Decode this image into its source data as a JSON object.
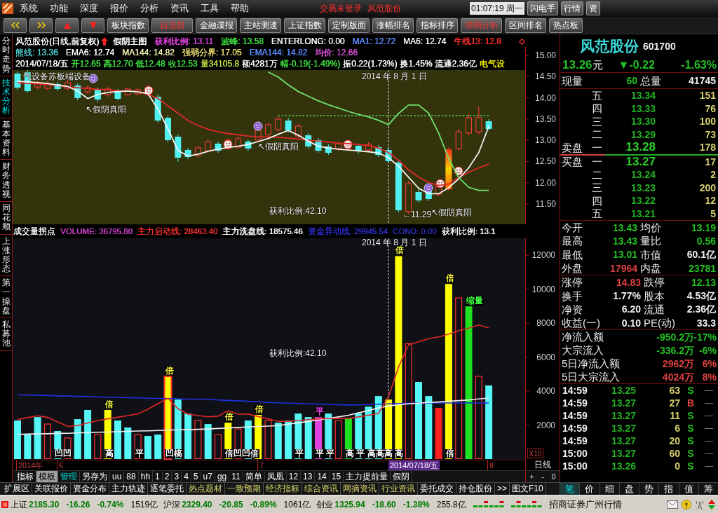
{
  "menu_bar": {
    "items": [
      "系统",
      "功能",
      "深度",
      "报价",
      "分析",
      "资讯",
      "工具",
      "帮助"
    ],
    "notices": [
      "交易未登录",
      "风范股份"
    ],
    "clock": "01:07:19 周一",
    "buttons": [
      "闪电手",
      "行情",
      "资"
    ]
  },
  "toolbar": {
    "buttons": [
      {
        "label": "板块指数",
        "highlighted": false
      },
      {
        "label": "自选股",
        "highlighted": true
      },
      {
        "label": "金融谍报",
        "highlighted": false
      },
      {
        "label": "主站测速",
        "highlighted": false
      },
      {
        "label": "上证指数",
        "highlighted": false
      },
      {
        "label": "定制版面",
        "highlighted": false
      },
      {
        "label": "涨幅排名",
        "highlighted": false
      },
      {
        "label": "指标排序",
        "highlighted": false
      },
      {
        "label": "强弱分析",
        "highlighted": true
      },
      {
        "label": "区间排名",
        "highlighted": false
      },
      {
        "label": "热点板",
        "highlighted": false
      }
    ]
  },
  "side_tabs": [
    {
      "label": "分时走势",
      "selected": false
    },
    {
      "label": "技术分析",
      "selected": true
    },
    {
      "label": "基本资料",
      "selected": false
    },
    {
      "label": "财务透视",
      "selected": false
    },
    {
      "label": "同花顺",
      "selected": false
    },
    {
      "label": "上涨形态",
      "selected": false
    },
    {
      "label": "第一操盘",
      "selected": false
    },
    {
      "label": "私募池",
      "selected": false
    }
  ],
  "chart_header": {
    "lines": [
      [
        {
          "text": "风范股份(日线,前复权)",
          "color": "#ffffff"
        },
        {
          "text": "假阴主图",
          "color": "#ffffff"
        },
        {
          "text": "获利比例: 13.11",
          "color": "#e040e0"
        },
        {
          "text": "波峰: 13.58",
          "color": "#40e040"
        },
        {
          "text": "ENTERLONG: 0.00",
          "color": "#ffffff"
        },
        {
          "text": "MA1: 12.72",
          "color": "#5a8cff"
        },
        {
          "text": "MA6: 12.74",
          "color": "#ffffff"
        },
        {
          "text": "牛线13: 12.8",
          "color": "#ff3030"
        }
      ],
      [
        {
          "text": "熊线: 13.36",
          "color": "#50d0d0"
        },
        {
          "text": "EMA6: 12.74",
          "color": "#ffffff"
        },
        {
          "text": "MA144: 14.82",
          "color": "#f0f0b0"
        },
        {
          "text": "强弱分界: 17.05",
          "color": "#f0e070"
        },
        {
          "text": "EMA144: 14.82",
          "color": "#5a8cff"
        },
        {
          "text": "均价: 12.66",
          "color": "#d050d0"
        }
      ],
      [
        {
          "text": "2014/07/18/五",
          "color": "#ffffff"
        },
        {
          "text": "开12.65",
          "color": "#40e040"
        },
        {
          "text": "高12.70",
          "color": "#40e040"
        },
        {
          "text": "低12.48",
          "color": "#40e040"
        },
        {
          "text": "收12.53",
          "color": "#40e040"
        },
        {
          "text": "量34105.8",
          "color": "#c0e040"
        },
        {
          "text": "额4281万",
          "color": "#ffffff"
        },
        {
          "text": "幅-0.19(-1.49%)",
          "color": "#40e040"
        },
        {
          "text": "振0.22(1.73%)",
          "color": "#ffffff"
        },
        {
          "text": "换1.45%",
          "color": "#ffffff"
        },
        {
          "text": "流通2.36亿",
          "color": "#ffffff"
        },
        {
          "text": "电气设",
          "color": "#f0f000"
        }
      ]
    ]
  },
  "price_chart": {
    "labels": [
      "气设备苏板端设备",
      "2014 年 8 月 1 日",
      "↖假阴真阳",
      "↖假阴真阳",
      "获利比例:42.10",
      "←11.29",
      "↖假阴真阳"
    ],
    "chart_data": {
      "type": "line",
      "categories": [
        null,
        null,
        null,
        null,
        null,
        null,
        null,
        null,
        null,
        null,
        null,
        null,
        null,
        null,
        null,
        null,
        null,
        null,
        null,
        null,
        null,
        null,
        null,
        null,
        null,
        null,
        null,
        null,
        null,
        null,
        null,
        null,
        null,
        null,
        null,
        null,
        null,
        null,
        null,
        null,
        null,
        null,
        null,
        null,
        null,
        null,
        null,
        null
      ],
      "ylim": [
        11.02,
        15.2
      ],
      "yticks": [
        {
          "value": 15,
          "label": "15.00"
        },
        {
          "value": 14.5,
          "label": "14.50"
        },
        {
          "value": 14,
          "label": "14.00"
        },
        {
          "value": 13.5,
          "label": "13.50"
        },
        {
          "value": 13,
          "label": "13.00"
        },
        {
          "value": 12.5,
          "label": "12.50"
        },
        {
          "value": 12,
          "label": "12.00"
        },
        {
          "value": 11.5,
          "label": "11.50"
        }
      ],
      "series": [
        {
          "color": "#e02828",
          "values": [
            14.36,
            14.34,
            14.33,
            14.31,
            14.29,
            14.26,
            14.24,
            14.22,
            14.2,
            14.19,
            14.17,
            14.16,
            14.15,
            14.08,
            13.99,
            13.81,
            13.64,
            13.47,
            13.35,
            13.26,
            13.2,
            13.16,
            13.13,
            13.1,
            13.08,
            13.08,
            13.07,
            13.05,
            13.03,
            13.0,
            12.98,
            12.96,
            12.93,
            12.92,
            12.9,
            12.87,
            12.82,
            12.71,
            12.53,
            12.3,
            12.13,
            12.01,
            11.93,
            11.97,
            12.12,
            12.25,
            12.35,
            12.44
          ]
        },
        {
          "color": "#f4f4f4",
          "values": [
            14.39,
            14.38,
            14.36,
            14.34,
            14.3,
            14.27,
            14.16,
            13.98,
            14.08,
            14.13,
            14.15,
            14.16,
            14.14,
            14.1,
            13.74,
            13.27,
            12.76,
            12.63,
            12.67,
            12.74,
            12.79,
            12.83,
            12.86,
            12.9,
            12.97,
            13.04,
            13.14,
            13.23,
            13.12,
            12.98,
            12.86,
            12.82,
            12.79,
            12.77,
            12.75,
            12.73,
            12.7,
            12.59,
            12.39,
            12.13,
            11.87,
            11.74,
            11.74,
            11.88,
            12.09,
            12.35,
            12.71,
            13.33
          ]
        },
        {
          "color": "#70e070",
          "values": [
            null,
            null,
            null,
            null,
            null,
            null,
            null,
            null,
            null,
            null,
            null,
            null,
            null,
            null,
            null,
            null,
            null,
            null,
            null,
            null,
            null,
            null,
            null,
            null,
            null,
            14.61,
            14.49,
            14.31,
            14.15,
            14.04,
            13.93,
            13.84,
            13.76,
            13.68,
            13.61,
            13.55,
            13.47,
            13.37,
            13.63,
            13.83,
            13.83,
            13.64,
            13.17,
            12.57,
            12.12,
            11.89,
            11.82,
            11.82
          ]
        },
        {
          "color": "#50d050",
          "line_style": "dashed",
          "values": [
            null,
            null,
            null,
            null,
            null,
            null,
            null,
            null,
            null,
            null,
            null,
            null,
            null,
            null,
            null,
            null,
            null,
            null,
            null,
            null,
            null,
            null,
            null,
            null,
            null,
            null,
            13.58,
            13.58,
            13.58,
            13.58,
            13.58,
            13.58,
            13.58,
            13.58,
            13.58,
            13.58,
            13.58,
            13.58,
            13.58,
            13.58,
            13.58,
            13.58,
            13.58,
            13.58,
            13.58,
            13.58,
            13.58,
            13.58
          ]
        }
      ]
    }
  },
  "volume_header": {
    "items": [
      {
        "text": "成交量拐点",
        "color": "#ffffff"
      },
      {
        "text": "VOLUME: 36795.80",
        "color": "#d040d0"
      },
      {
        "text": "主力启动线: 28463.40",
        "color": "#ff3030"
      },
      {
        "text": "主力洗盘线: 18575.46",
        "color": "#ffffff"
      },
      {
        "text": "资金异动线: 29945.54",
        "color": "#3030d8"
      },
      {
        "text": "COND: 0.00",
        "color": "#2c2cb8"
      },
      {
        "text": "获利比例: 13.1",
        "color": "#ffffff"
      }
    ]
  },
  "volume_chart": {
    "labels": [
      "2014 年 8 月 1 日",
      "获利比例:42.10"
    ],
    "scale_label": "X10",
    "signals": [
      {
        "text": "倍",
        "color": "#ffff40"
      },
      {
        "text": "倍",
        "color": "#ffff40"
      },
      {
        "text": "缩量",
        "color": "#40ff40"
      },
      {
        "text": "倍",
        "color": "#ffff40"
      },
      {
        "text": "倍",
        "color": "#ffff40"
      },
      {
        "text": "倍",
        "color": "#ffff40"
      },
      {
        "text": "平",
        "color": "#ff40ff"
      },
      {
        "text": "倍",
        "color": "#ffff40"
      },
      {
        "text": "凹凹",
        "color": "#ffffff"
      },
      {
        "text": "高",
        "color": "#ffffff"
      },
      {
        "text": "平",
        "color": "#ffffff"
      },
      {
        "text": "凹槁",
        "color": "#ffffff"
      },
      {
        "text": "倍凹凹倍",
        "color": "#ffffff"
      },
      {
        "text": "平",
        "color": "#ffffff"
      },
      {
        "text": "平 平",
        "color": "#ffffff"
      },
      {
        "text": "高 平 高高高 高",
        "color": "#ffffff"
      },
      {
        "text": "倍",
        "color": "#ffffff"
      }
    ],
    "chart_data": {
      "type": "bar",
      "categories": [
        null,
        null,
        null,
        null,
        null,
        null,
        null,
        null,
        null,
        null,
        null,
        null,
        null,
        null,
        null,
        null,
        null,
        null,
        null,
        null,
        null,
        null,
        null,
        null,
        null,
        null,
        null,
        null,
        null,
        null,
        null,
        null,
        null,
        null,
        null,
        null,
        null,
        null,
        null,
        null,
        null,
        null,
        null,
        null,
        null,
        null,
        null,
        null
      ],
      "ylim": [
        0,
        13000
      ],
      "yticks": [
        {
          "value": 2000,
          "label": "2000"
        },
        {
          "value": 4000,
          "label": "4000"
        },
        {
          "value": 6000,
          "label": "6000"
        },
        {
          "value": 8000,
          "label": "8000"
        },
        {
          "value": 10000,
          "label": "10000"
        },
        {
          "value": 12000,
          "label": "12000"
        }
      ],
      "series": [
        {
          "values": [
            2270,
            1440,
            2470,
            2060,
            1650,
            1240,
            2350,
            2890,
            1440,
            2890,
            2270,
            1860,
            1440,
            1360,
            1440,
            4870,
            3500,
            2680,
            2270,
            2060,
            1440,
            2140,
            1770,
            2270,
            2600,
            2270,
            2140,
            2270,
            2680,
            2470,
            2470,
            2680,
            2270,
            2390,
            2680,
            3090,
            3710,
            3500,
            11950,
            6800,
            4540,
            3710,
            3010,
            10310,
            9490,
            8990,
            4870,
            4330
          ],
          "colors": [
            "#54f6f6",
            "#54f6f6",
            "#54f6f6",
            "#ff3030",
            "#54f6f6",
            "#ff3030",
            "#54f6f6",
            "#54f6f6",
            "#ff3030",
            "#ffff00",
            "#54f6f6",
            "#54f6f6",
            "#ff3030",
            "#54f6f6",
            "#54f6f6",
            "#ffff00",
            "#54f6f6",
            "#54f6f6",
            "#ff3030",
            "#54f6f6",
            "#ff3030",
            "#ffff00",
            "#ff3030",
            "#54f6f6",
            "#ffff00",
            "#ff3030",
            "#54f6f6",
            "#54f6f6",
            "#54f6f6",
            "#54f6f6",
            "#e040e0",
            "#54f6f6",
            "#ff3030",
            "#20e020",
            "#54f6f6",
            "#54f6f6",
            "#54f6f6",
            "#ffff00",
            "#ffff00",
            "#ff3030",
            "#54f6f6",
            "#54f6f6",
            "#ff2020",
            "#ffff00",
            "#ff3030",
            "#20e020",
            "#ff3030",
            "#54f6f6"
          ]
        },
        {
          "type": "line",
          "color": "#2030e0",
          "values": [
            3790,
            3770,
            3760,
            3740,
            3720,
            3710,
            3690,
            3680,
            3660,
            3640,
            3630,
            3610,
            3600,
            3580,
            3570,
            3560,
            3550,
            3530,
            3530,
            3510,
            3480,
            3450,
            3430,
            3400,
            3370,
            3340,
            3310,
            3290,
            3270,
            3250,
            3240,
            3220,
            3200,
            3180,
            3190,
            3210,
            3230,
            3250,
            3270,
            3290,
            3300,
            3300,
            3300,
            3300,
            3300,
            3300,
            3300,
            3300
          ]
        },
        {
          "type": "line",
          "color": "#f4f4f4",
          "values": [
            1450,
            1470,
            1480,
            1490,
            1510,
            1520,
            1540,
            1560,
            1580,
            1590,
            1610,
            1630,
            1650,
            1660,
            1680,
            1700,
            1720,
            1730,
            1750,
            1770,
            1800,
            1830,
            1860,
            1890,
            1920,
            1940,
            1970,
            2050,
            2130,
            2210,
            2300,
            2390,
            2480,
            2580,
            2720,
            2860,
            3010,
            3120,
            3200,
            3250,
            3290,
            3330,
            3360,
            3400,
            3440,
            3480,
            3540,
            3590
          ]
        },
        {
          "type": "line",
          "color": "#e02828",
          "values": [
            2320,
            2440,
            2550,
            2450,
            2190,
            1920,
            1970,
            2120,
            2260,
            2370,
            2460,
            2560,
            2660,
            2930,
            3260,
            3580,
            2960,
            2640,
            2560,
            2490,
            2520,
            2840,
            2640,
            2650,
            2500,
            2360,
            2220,
            2220,
            2270,
            2320,
            2370,
            2380,
            2390,
            2390,
            2480,
            2580,
            2680,
            3680,
            5420,
            6730,
            6900,
            7090,
            7190,
            7360,
            7560,
            7710,
            7890,
            7720
          ]
        }
      ]
    }
  },
  "date_axis": {
    "labels": [
      {
        "text": "2014年",
        "kind": "tick"
      },
      {
        "text": "6",
        "kind": "tick"
      },
      {
        "text": "7",
        "kind": "tick"
      },
      {
        "text": "2014/07/18/五",
        "kind": "cursor"
      },
      {
        "text": "8",
        "kind": "tick"
      }
    ],
    "period": "日线"
  },
  "indicator_tabs": {
    "items": [
      {
        "label": "指标",
        "selected": false,
        "highlighted": false
      },
      {
        "label": "模板",
        "selected": true,
        "highlighted": false
      },
      {
        "label": "管理",
        "selected": false,
        "highlighted": true
      },
      {
        "label": "另存为",
        "selected": false,
        "highlighted": false
      },
      {
        "label": "uu",
        "selected": false,
        "highlighted": false
      },
      {
        "label": "88",
        "selected": false,
        "highlighted": false
      },
      {
        "label": "hh",
        "selected": false,
        "highlighted": false
      },
      {
        "label": "1",
        "selected": false,
        "highlighted": false
      },
      {
        "label": "2",
        "selected": false,
        "highlighted": false
      },
      {
        "label": "3",
        "selected": false,
        "highlighted": false
      },
      {
        "label": "4",
        "selected": false,
        "highlighted": false
      },
      {
        "label": "5",
        "selected": false,
        "highlighted": false
      },
      {
        "label": "u7",
        "selected": false,
        "highlighted": false
      },
      {
        "label": "gg",
        "selected": false,
        "highlighted": false
      },
      {
        "label": "11",
        "selected": false,
        "highlighted": false
      },
      {
        "label": "简单",
        "selected": false,
        "highlighted": false
      },
      {
        "label": "凤凰",
        "selected": false,
        "highlighted": false
      },
      {
        "label": "12",
        "selected": false,
        "highlighted": false
      },
      {
        "label": "13",
        "selected": false,
        "highlighted": false
      },
      {
        "label": "14",
        "selected": false,
        "highlighted": false
      },
      {
        "label": "15",
        "selected": false,
        "highlighted": false
      },
      {
        "label": "主力提前量",
        "selected": false,
        "highlighted": false
      },
      {
        "label": "假阴",
        "selected": false,
        "highlighted": false
      }
    ],
    "zoom_buttons": [
      "+",
      "-",
      "0"
    ]
  },
  "function_bar": {
    "items": [
      {
        "label": "扩展区",
        "highlighted": false
      },
      {
        "label": "关联报价",
        "highlighted": false
      },
      {
        "label": "资金分布",
        "highlighted": false
      },
      {
        "label": "主力轨迹",
        "highlighted": false
      },
      {
        "label": "逐笔委托",
        "highlighted": false
      },
      {
        "label": "热点题材",
        "highlighted": true
      },
      {
        "label": "一致预期",
        "highlighted": true
      },
      {
        "label": "经济指标",
        "highlighted": true
      },
      {
        "label": "综合资讯",
        "highlighted": true
      },
      {
        "label": "网摘资讯",
        "highlighted": true
      },
      {
        "label": "行业资讯",
        "highlighted": true
      },
      {
        "label": "委托成交",
        "highlighted": false
      },
      {
        "label": "持仓股份",
        "highlighted": false
      },
      {
        "label": ">>",
        "highlighted": false
      },
      {
        "label": "图文F10",
        "highlighted": false
      }
    ]
  },
  "quote": {
    "name": "风范股份",
    "code": "601700",
    "price": "13.26",
    "unit": "元",
    "change": "▼-0.22",
    "change_pct": "-1.63%",
    "falling": true,
    "volume_stats": [
      {
        "label": "现量",
        "value": "60",
        "color": "#22c022"
      },
      {
        "label": "总量",
        "value": "41745",
        "color": "#f0f0f0"
      }
    ],
    "asks": [
      {
        "rank": "五",
        "price": "13.34",
        "volume": "151",
        "best": false
      },
      {
        "rank": "四",
        "price": "13.33",
        "volume": "76",
        "best": false
      },
      {
        "rank": "三",
        "price": "13.30",
        "volume": "100",
        "best": false
      },
      {
        "rank": "二",
        "price": "13.29",
        "volume": "73",
        "best": false
      },
      {
        "label": "卖盘",
        "rank": "一",
        "price": "13.28",
        "volume": "178",
        "best": true
      }
    ],
    "bids": [
      {
        "label": "买盘",
        "rank": "一",
        "price": "13.27",
        "volume": "17",
        "best": true
      },
      {
        "rank": "二",
        "price": "13.24",
        "volume": "2",
        "best": false
      },
      {
        "rank": "三",
        "price": "13.23",
        "volume": "200",
        "best": false
      },
      {
        "rank": "四",
        "price": "13.22",
        "volume": "12",
        "best": false
      },
      {
        "rank": "五",
        "price": "13.21",
        "volume": "5",
        "best": false
      }
    ],
    "stat_groups": [
      [
        {
          "label": "今开",
          "value": "13.43",
          "color": "#22c022"
        },
        {
          "label": "均价",
          "value": "13.19",
          "color": "#22c022"
        },
        {
          "label": "最高",
          "value": "13.43",
          "color": "#22c022"
        },
        {
          "label": "量比",
          "value": "0.56",
          "color": "#22c022"
        },
        {
          "label": "最低",
          "value": "13.01",
          "color": "#22c022"
        },
        {
          "label": "市值",
          "value": "60.1亿",
          "color": "#f0f0f0"
        },
        {
          "label": "外盘",
          "value": "17964",
          "color": "#e04040"
        },
        {
          "label": "内盘",
          "value": "23781",
          "color": "#22c022"
        }
      ],
      [
        {
          "label": "涨停",
          "value": "14.83",
          "color": "#e04040"
        },
        {
          "label": "跌停",
          "value": "12.13",
          "color": "#22c022"
        },
        {
          "label": "换手",
          "value": "1.77%",
          "color": "#f0f0f0"
        },
        {
          "label": "股本",
          "value": "4.53亿",
          "color": "#f0f0f0"
        },
        {
          "label": "净资",
          "value": "6.20",
          "color": "#f0f0f0"
        },
        {
          "label": "流通",
          "value": "2.36亿",
          "color": "#f0f0f0"
        },
        {
          "label": "收益(一)",
          "value": "0.10",
          "color": "#f0f0f0"
        },
        {
          "label": "PE(动)",
          "value": "33.3",
          "color": "#f0f0f0"
        }
      ]
    ],
    "flows": [
      {
        "label": "净流入额",
        "amount": "-950.2万",
        "pct": "-17%",
        "color": "#22c022"
      },
      {
        "label": "大宗流入",
        "amount": "-336.2万",
        "pct": "-6%",
        "color": "#22c022"
      },
      {
        "label": "5日净流入额",
        "amount": "2962万",
        "pct": "6%",
        "color": "#e04040"
      },
      {
        "label": "5日大宗流入",
        "amount": "4024万",
        "pct": "8%",
        "color": "#e04040"
      }
    ],
    "ticks": [
      {
        "time": "14:59",
        "price": "13.25",
        "volume": "63",
        "side": "S",
        "color": "#22c022",
        "status": "—"
      },
      {
        "time": "14:59",
        "price": "13.27",
        "volume": "27",
        "side": "B",
        "color": "#e04040",
        "status": "—"
      },
      {
        "time": "14:59",
        "price": "13.27",
        "volume": "11",
        "side": "S",
        "color": "#22c022",
        "status": "—"
      },
      {
        "time": "14:59",
        "price": "13.27",
        "volume": "6",
        "side": "S",
        "color": "#22c022",
        "status": "—"
      },
      {
        "time": "14:59",
        "price": "13.27",
        "volume": "20",
        "side": "S",
        "color": "#22c022",
        "status": "—"
      },
      {
        "time": "15:00",
        "price": "13.27",
        "volume": "60",
        "side": "S",
        "color": "#22c022",
        "status": "—"
      },
      {
        "time": "15:00",
        "price": "13.26",
        "volume": "0",
        "side": "S",
        "color": "#22c022",
        "status": "—"
      }
    ]
  },
  "quote_tabs": [
    {
      "label": "笔",
      "selected": true
    },
    {
      "label": "价",
      "selected": false
    },
    {
      "label": "细",
      "selected": false
    },
    {
      "label": "盘",
      "selected": false
    },
    {
      "label": "势",
      "selected": false
    },
    {
      "label": "指",
      "selected": false
    },
    {
      "label": "值",
      "selected": false
    },
    {
      "label": "筹",
      "selected": false
    }
  ],
  "status_bar": {
    "indices": [
      {
        "name": "上证",
        "value": "2185.30",
        "change": "-16.26",
        "pct": "-0.74%",
        "amount": "1519亿",
        "falling": true
      },
      {
        "name": "沪深",
        "value": "2329.40",
        "change": "-20.85",
        "pct": "-0.89%",
        "amount": "1061亿",
        "falling": true
      },
      {
        "name": "创业",
        "value": "1325.94",
        "change": "-18.60",
        "pct": "-1.38%",
        "amount": "255.8亿",
        "falling": true
      }
    ],
    "broker": "招商证券广州行情"
  }
}
